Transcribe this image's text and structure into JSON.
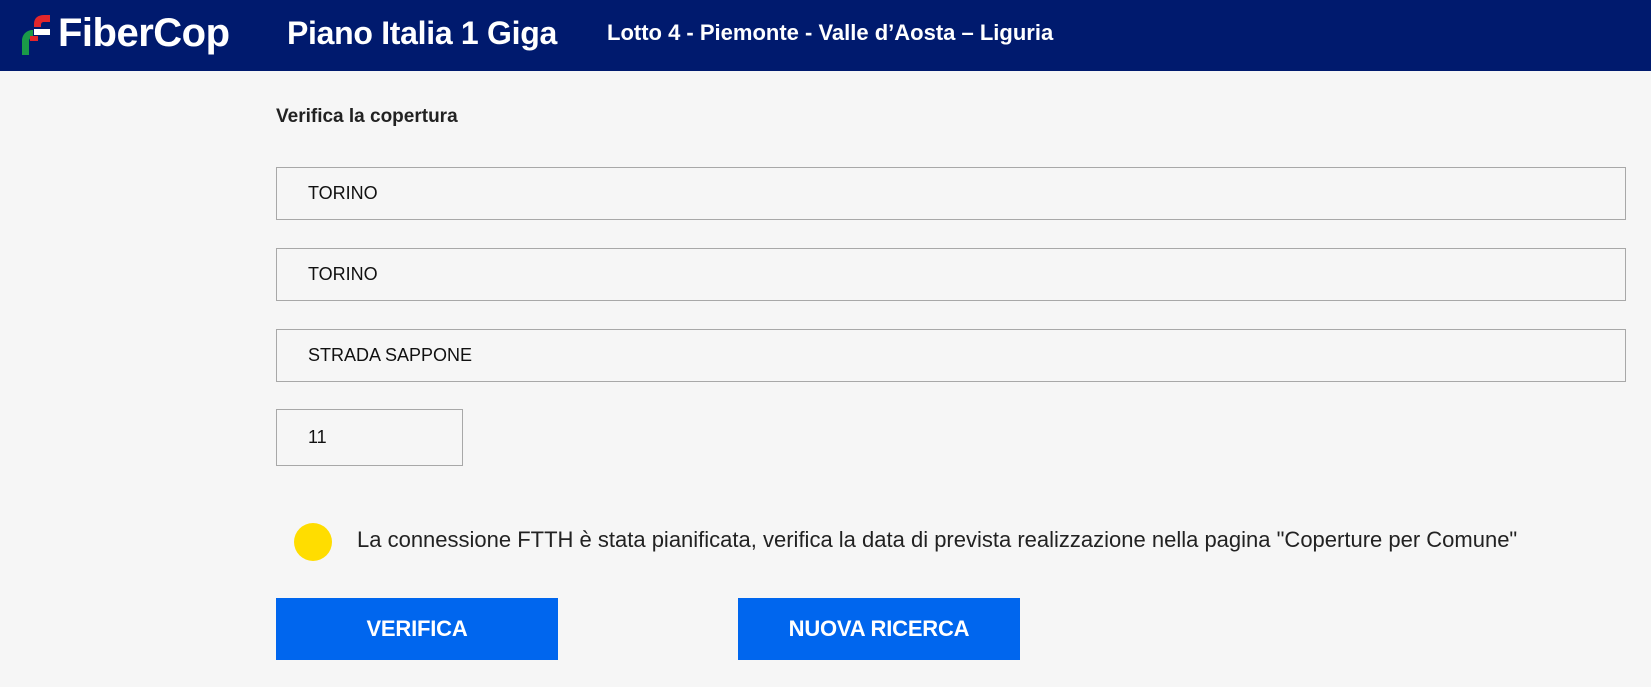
{
  "header": {
    "logo_text": "FiberCop",
    "app_title": "Piano Italia 1 Giga",
    "lot_title": "Lotto 4 - Piemonte - Valle d’Aosta – Liguria",
    "background_color": "#001a6e"
  },
  "form": {
    "title": "Verifica la copertura",
    "provincia_value": "TORINO",
    "comune_value": "TORINO",
    "indirizzo_value": "STRADA SAPPONE",
    "civico_value": "11"
  },
  "status": {
    "indicator_color": "#ffdd00",
    "message": "La connessione FTTH è stata pianificata, verifica la data di prevista realizzazione nella pagina \"Coperture per Comune\""
  },
  "buttons": {
    "verifica_label": "VERIFICA",
    "nuova_ricerca_label": "NUOVA RICERCA",
    "color": "#0066ee"
  }
}
